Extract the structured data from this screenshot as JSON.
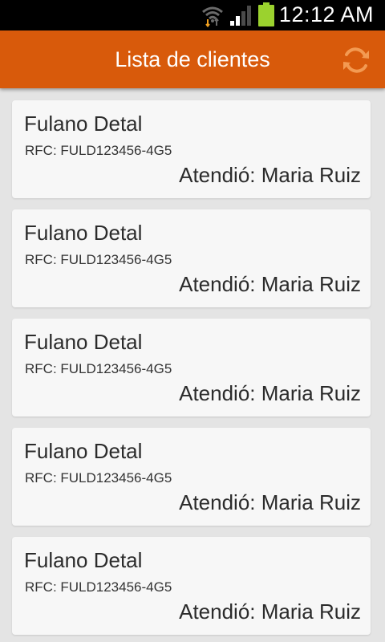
{
  "status_bar": {
    "time": "12:12 AM",
    "icons": [
      "wifi-icon",
      "signal-icon",
      "battery-icon"
    ]
  },
  "app_bar": {
    "title": "Lista de clientes",
    "action_icon": "refresh-icon"
  },
  "colors": {
    "accent": "#d85a0b",
    "refresh_icon": "#f39a52",
    "battery": "#9bd22e",
    "list_background": "#e4e4e4",
    "card_background": "#f7f7f7"
  },
  "clients": [
    {
      "name": "Fulano Detal",
      "rfc": "RFC: FULD123456-4G5",
      "attended_by": "Atendió: Maria Ruiz"
    },
    {
      "name": "Fulano Detal",
      "rfc": "RFC: FULD123456-4G5",
      "attended_by": "Atendió: Maria Ruiz"
    },
    {
      "name": "Fulano Detal",
      "rfc": "RFC: FULD123456-4G5",
      "attended_by": "Atendió: Maria Ruiz"
    },
    {
      "name": "Fulano Detal",
      "rfc": "RFC: FULD123456-4G5",
      "attended_by": "Atendió: Maria Ruiz"
    },
    {
      "name": "Fulano Detal",
      "rfc": "RFC: FULD123456-4G5",
      "attended_by": "Atendió: Maria Ruiz"
    }
  ]
}
